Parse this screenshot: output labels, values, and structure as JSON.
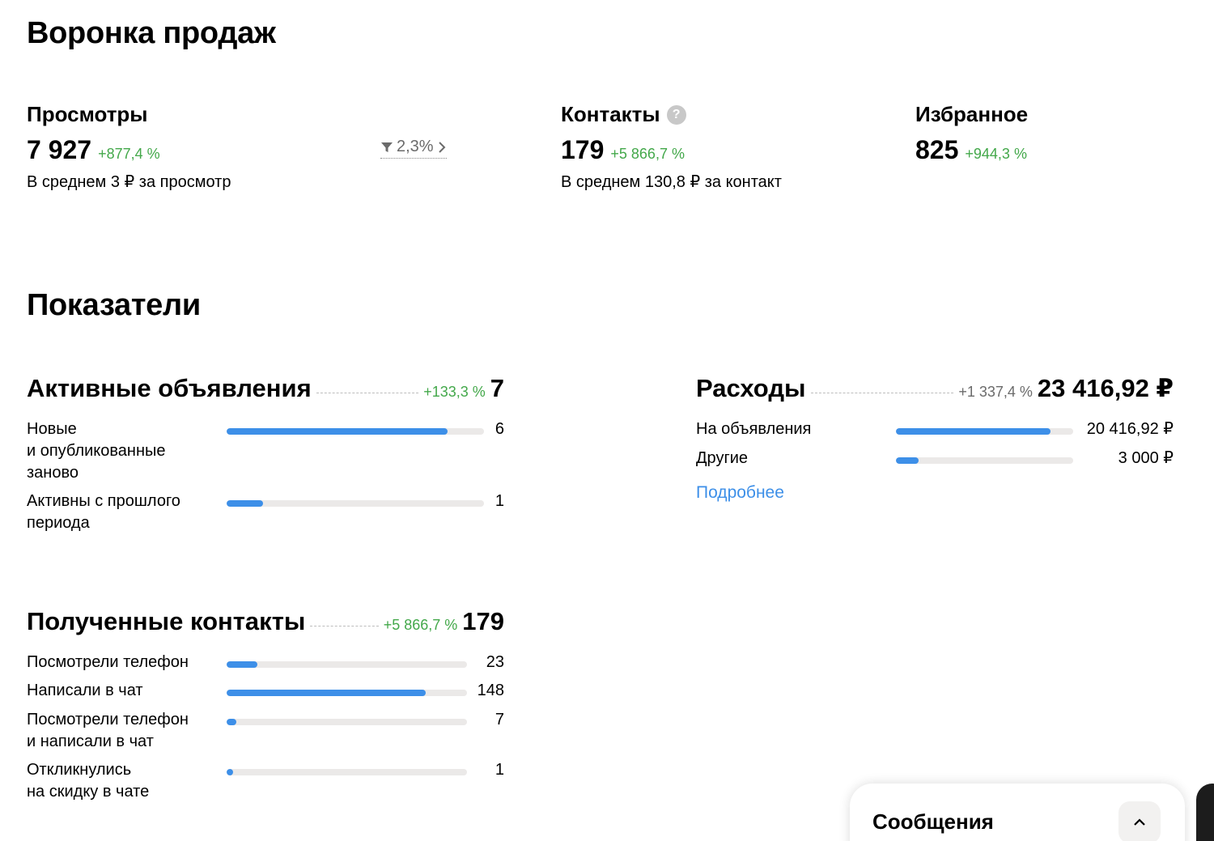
{
  "funnel": {
    "title": "Воронка продаж",
    "views": {
      "label": "Просмотры",
      "value": "7 927",
      "delta": "+877,4 %",
      "sub": "В среднем 3 ₽ за просмотр"
    },
    "conversion": {
      "value": "2,3%"
    },
    "contacts": {
      "label": "Контакты",
      "help": "?",
      "value": "179",
      "delta": "+5 866,7 %",
      "sub": "В среднем 130,8 ₽ за контакт"
    },
    "favorites": {
      "label": "Избранное",
      "value": "825",
      "delta": "+944,3 %"
    }
  },
  "metrics": {
    "title": "Показатели",
    "active_ads": {
      "title": "Активные объявления",
      "delta": "+133,3 %",
      "total": "7",
      "rows": [
        {
          "label_lines": [
            "Новые",
            "и опубликованные",
            "заново"
          ],
          "value": "6",
          "fill": 0.857
        },
        {
          "label_lines": [
            "Активны с прошлого",
            "периода"
          ],
          "value": "1",
          "fill": 0.143
        }
      ]
    },
    "expenses": {
      "title": "Расходы",
      "delta": "+1 337,4 %",
      "total": "23 416,92 ₽",
      "rows": [
        {
          "label": "На объявления",
          "value": "20 416,92 ₽",
          "fill": 0.872
        },
        {
          "label": "Другие",
          "value": "3 000 ₽",
          "fill": 0.128
        }
      ],
      "more_link": "Подробнее"
    },
    "contacts_received": {
      "title": "Полученные контакты",
      "delta": "+5 866,7 %",
      "total": "179",
      "rows": [
        {
          "label_lines": [
            "Посмотрели телефон"
          ],
          "value": "23",
          "fill": 0.128
        },
        {
          "label_lines": [
            "Написали в чат"
          ],
          "value": "148",
          "fill": 0.827
        },
        {
          "label_lines": [
            "Посмотрели телефон",
            "и написали в чат"
          ],
          "value": "7",
          "fill": 0.039
        },
        {
          "label_lines": [
            "Откликнулись",
            "на скидку в чате"
          ],
          "value": "1",
          "fill": 0.028
        }
      ]
    }
  },
  "messages_widget": {
    "title": "Сообщения"
  },
  "colors": {
    "accent": "#3d8fe8",
    "positive": "#43a84a",
    "track": "#ebe9e8"
  }
}
